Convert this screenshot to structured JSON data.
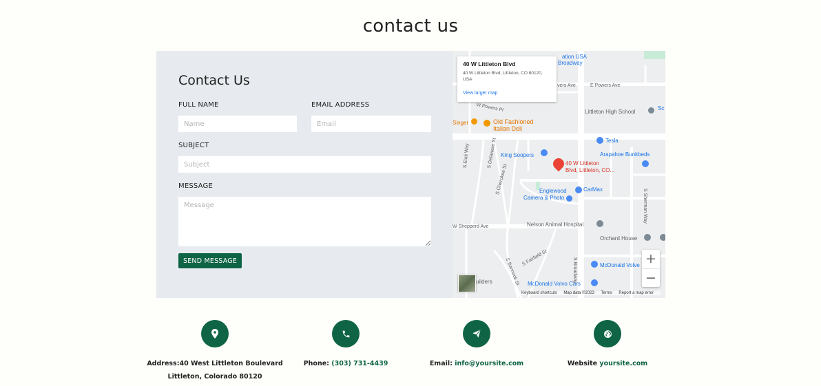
{
  "page": {
    "title": "contact us"
  },
  "form": {
    "heading": "Contact Us",
    "full_name_label": "FULL NAME",
    "full_name_placeholder": "Name",
    "email_label": "EMAIL ADDRESS",
    "email_placeholder": "Email",
    "subject_label": "SUBJECT",
    "subject_placeholder": "Subject",
    "message_label": "MESSAGE",
    "message_placeholder": "Message",
    "send_label": "SEND MESSAGE"
  },
  "map": {
    "card_title": "40 W Littleton Blvd",
    "card_address": "40 W Littleton Blvd, Littleton, CO 80120, USA",
    "card_link": "View larger map",
    "pin_label_1": "40 W Littleton",
    "pin_label_2": "Blvd, Littleton, CO...",
    "places": {
      "lutheran_1": "ation USA",
      "lutheran_2": "Broadway",
      "powers_w": "vers Ave",
      "powers_e": "E Powers Ave",
      "powers_pl": "W Powers Pl",
      "high_school": "Littleton High School",
      "sc": "Sc",
      "singer": "Singer",
      "old_fashioned_1": "Old Fashioned",
      "old_fashioned_2": "Italian Deli",
      "tesla": "Tesla",
      "arapahoe": "Arapahoe Bunkbeds",
      "king_soopers": "King Soopers",
      "carmax": "CarMax",
      "englewood_1": "Englewood",
      "englewood_2": "Camera & Photo",
      "shepperd": "W Shepperd Ave",
      "nelson": "Nelson Animal Hospital",
      "orchard": "Orchard House",
      "mcdonald_volvo": "McDonald Volve",
      "mcdonald_cars": "McDonald Volvo Cars",
      "builders": "uilders",
      "s_broadway": "S Broadway",
      "s_sherman": "S Sherman Way",
      "s_delaware": "S Delaware St",
      "s_cherokee": "S Cherokee St",
      "s_bannock": "S Bannock St",
      "s_fairfield": "S Fairfield St",
      "s_elati": "S Elati Way"
    },
    "footer": {
      "keyboard": "Keyboard shortcuts",
      "data": "Map data ©2023",
      "terms": "Terms",
      "report": "Report a map error"
    },
    "zoom_in": "+",
    "zoom_out": "−"
  },
  "info": {
    "address_label": "Address:",
    "address_line1": "40 West Littleton Boulevard",
    "address_line2": "Littleton, Colorado 80120",
    "phone_label": "Phone:",
    "phone_value": "(303) 731-4439",
    "email_label": "Email:",
    "email_value": "info@yoursite.com",
    "website_label": "Website",
    "website_value": "yoursite.com"
  },
  "colors": {
    "accent": "#0f6446",
    "form_bg": "#e7ebef",
    "page_bg": "#fefefa"
  },
  "icons": [
    "map-pin-icon",
    "phone-icon",
    "paper-plane-icon",
    "globe-icon"
  ]
}
